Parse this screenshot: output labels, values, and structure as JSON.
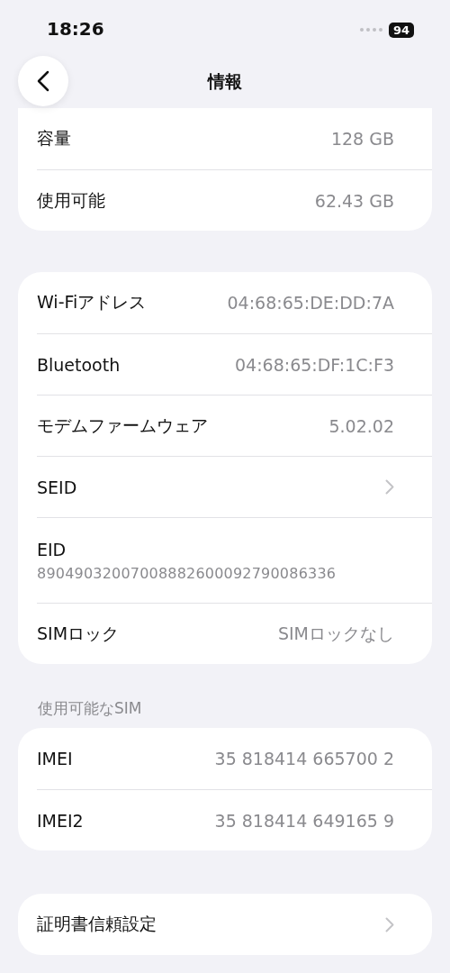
{
  "status_bar": {
    "time": "18:26",
    "battery": "94"
  },
  "nav": {
    "title": "情報"
  },
  "groups": [
    {
      "rows": [
        {
          "kind": "value",
          "label": "容量",
          "value": "128 GB"
        },
        {
          "kind": "value",
          "label": "使用可能",
          "value": "62.43 GB"
        }
      ]
    },
    {
      "rows": [
        {
          "kind": "value",
          "label": "Wi-Fiアドレス",
          "value": "04:68:65:DE:DD:7A"
        },
        {
          "kind": "value",
          "label": "Bluetooth",
          "value": "04:68:65:DF:1C:F3"
        },
        {
          "kind": "value",
          "label": "モデムファームウェア",
          "value": "5.02.02"
        },
        {
          "kind": "link",
          "label": "SEID"
        },
        {
          "kind": "stacked",
          "label": "EID",
          "value": "89049032007008882600092790086336"
        },
        {
          "kind": "value",
          "label": "SIMロック",
          "value": "SIMロックなし"
        }
      ]
    },
    {
      "header": "使用可能なSIM",
      "rows": [
        {
          "kind": "value",
          "label": "IMEI",
          "value": "35 818414 665700 2"
        },
        {
          "kind": "value",
          "label": "IMEI2",
          "value": "35 818414 649165 9"
        }
      ]
    },
    {
      "rows": [
        {
          "kind": "link",
          "label": "証明書信頼設定"
        }
      ]
    }
  ]
}
